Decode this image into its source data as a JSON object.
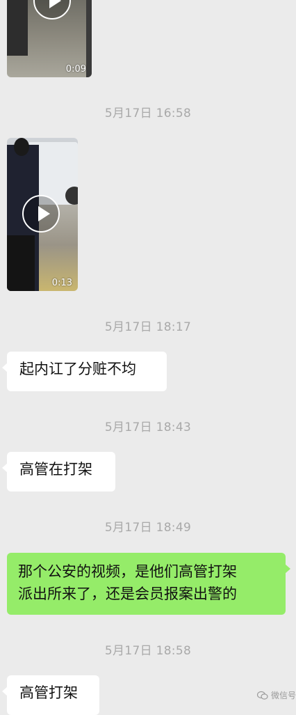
{
  "messages": {
    "video1_duration": "0:09",
    "ts1": "5月17日 16:58",
    "video2_duration": "0:13",
    "ts2": "5月17日 18:17",
    "msg1": "起内讧了分赃不均",
    "ts3": "5月17日 18:43",
    "msg2": "高管在打架",
    "ts4": "5月17日 18:49",
    "msg3_line1": "那个公安的视频，是他们高管打架",
    "msg3_line2": "派出所来了，还是会员报案出警的",
    "ts5": "5月17日 18:58",
    "msg4": "高管打架"
  },
  "watermark": {
    "label": "微信号",
    "icon": "wechat-icon"
  }
}
